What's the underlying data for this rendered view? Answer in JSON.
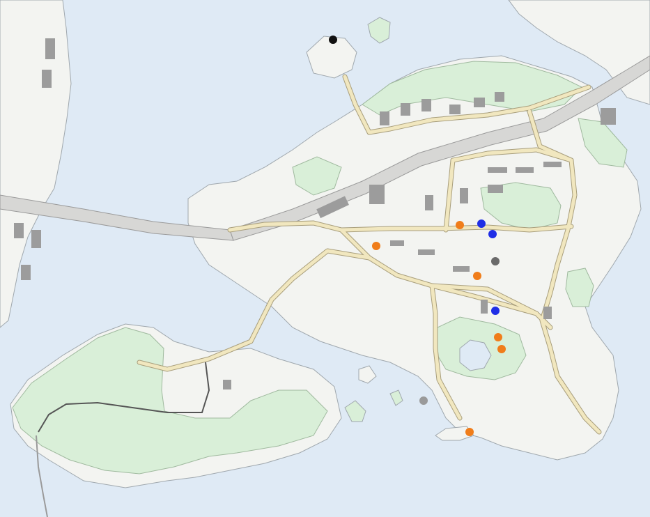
{
  "map": {
    "colors": {
      "water": "#dfeaf5",
      "land": "#f3f4f1",
      "park": "#d9efd8",
      "road_fill": "#f1e7bf",
      "road_edge": "#a89e7c",
      "building": "#9c9c9c",
      "highway": "#d7d7d5"
    },
    "markers": [
      {
        "name": "marker-black",
        "color": "#111111"
      },
      {
        "name": "marker-orange",
        "color": "#f07d1a"
      },
      {
        "name": "marker-blue",
        "color": "#1f2ee6"
      },
      {
        "name": "marker-gray",
        "color": "#6a6a6a"
      }
    ]
  }
}
